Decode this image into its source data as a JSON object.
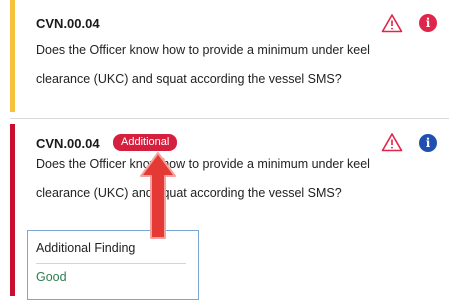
{
  "items": [
    {
      "code": "CVN.00.04",
      "question_line1": "Does the Officer know how to provide a minimum under keel",
      "question_line2": "clearance (UKC) and squat according the vessel SMS?",
      "status_color": "#f6c23e",
      "icons": [
        "warning-triangle-icon",
        "info-icon"
      ],
      "info_color": "#e0254a"
    },
    {
      "code": "CVN.00.04",
      "badge": "Additional",
      "question_line1": "Does the Officer know how to provide a minimum under keel",
      "question_line2": "clearance (UKC) and squat according the vessel SMS?",
      "status_color": "#c8102e",
      "icons": [
        "warning-triangle-icon",
        "info-icon"
      ],
      "info_color": "#1f4fb0"
    }
  ],
  "finding": {
    "label": "Additional Finding",
    "value": "Good"
  },
  "annotation": {
    "arrow_color": "#e53935"
  }
}
